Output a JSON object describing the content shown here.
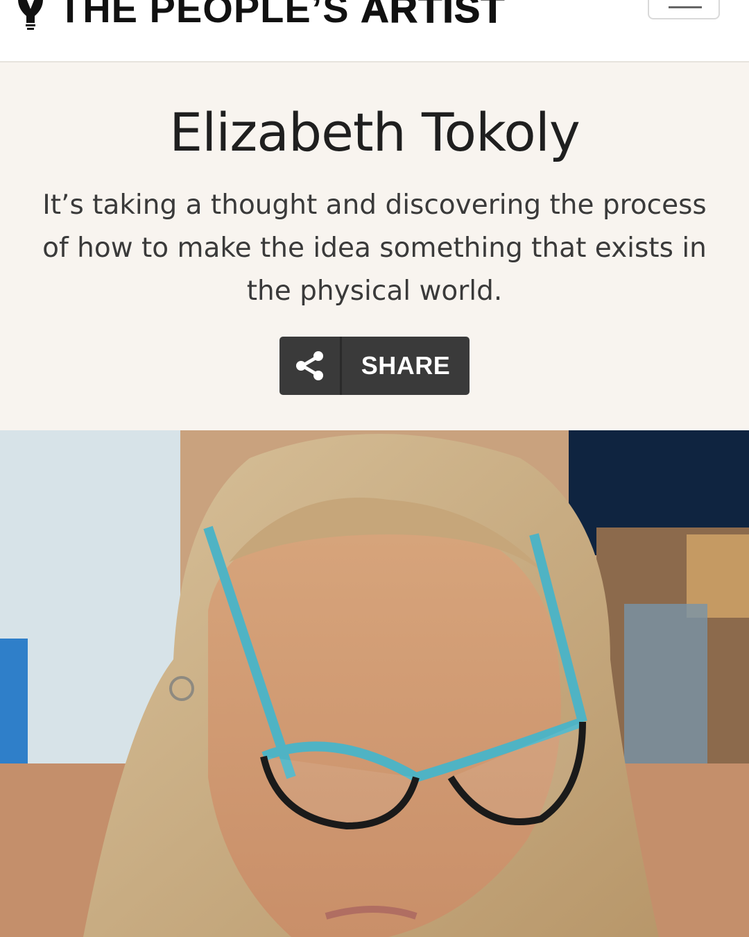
{
  "header": {
    "brand_left": "THE PEOPLE’S",
    "brand_right": "ARTIST",
    "logo_icon": "lightbulb-pencil-icon",
    "menu_icon": "hamburger-menu-icon"
  },
  "profile": {
    "name": "Elizabeth Tokoly",
    "quote": "It’s taking a thought and discovering the process of how to make the idea something that exists in the physical world.",
    "share_label": "SHARE",
    "share_icon": "share-icon"
  },
  "colors": {
    "hero_background": "#f8f4ef",
    "share_button": "#3a3a3a",
    "text_dark": "#1f1f1f"
  }
}
